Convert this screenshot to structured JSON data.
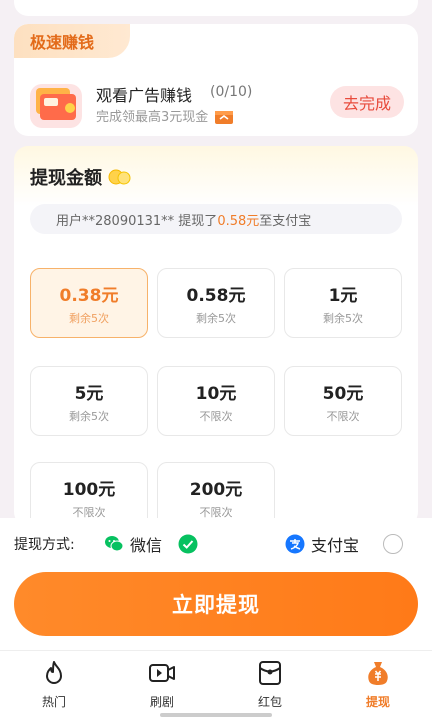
{
  "earn_card": {
    "tag": "极速赚钱",
    "task_title": "观看广告赚钱",
    "task_progress": "(0/10)",
    "task_sub": "完成领最高3元现金",
    "go_label": "去完成"
  },
  "amount_card": {
    "title": "提现金额",
    "notice_prefix": "用户**28090131** 提现了",
    "notice_amount": "0.58元",
    "notice_suffix": "至支付宝",
    "options": [
      {
        "amount": "0.38元",
        "sub": "剩余5次",
        "selected": true
      },
      {
        "amount": "0.58元",
        "sub": "剩余5次",
        "selected": false
      },
      {
        "amount": "1元",
        "sub": "剩余5次",
        "selected": false
      },
      {
        "amount": "5元",
        "sub": "剩余5次",
        "selected": false
      },
      {
        "amount": "10元",
        "sub": "不限次",
        "selected": false
      },
      {
        "amount": "50元",
        "sub": "不限次",
        "selected": false
      },
      {
        "amount": "100元",
        "sub": "不限次",
        "selected": false
      },
      {
        "amount": "200元",
        "sub": "不限次",
        "selected": false
      }
    ]
  },
  "payment": {
    "label": "提现方式:",
    "wechat": "微信",
    "alipay": "支付宝",
    "selected": "wechat"
  },
  "action": {
    "withdraw_label": "立即提现"
  },
  "tabbar": {
    "items": [
      {
        "label": "热门",
        "icon": "flame-icon",
        "active": false
      },
      {
        "label": "刷剧",
        "icon": "video-icon",
        "active": false
      },
      {
        "label": "红包",
        "icon": "red-envelope-icon",
        "active": false
      },
      {
        "label": "提现",
        "icon": "money-bag-icon",
        "active": true
      }
    ]
  },
  "colors": {
    "accent": "#ff7a18",
    "wechat_green": "#07c160",
    "alipay_blue": "#1677ff"
  }
}
